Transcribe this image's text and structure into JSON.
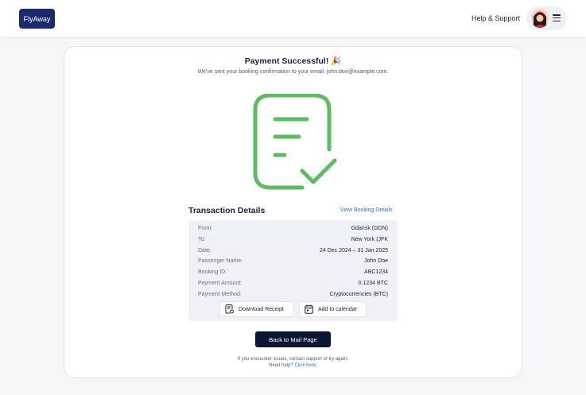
{
  "header": {
    "logo_text": "FlyAway",
    "help_label": "Help & Support",
    "menu_icon": "hamburger-menu-icon"
  },
  "main": {
    "title": "Payment Successful! 🎉",
    "subtitle": "We've sent your booking confirmation to your email: john.doe@example.com.",
    "success_icon": "receipt-check-icon",
    "transaction_heading": "Transaction Details",
    "view_booking_label": "View Booking Details",
    "details": [
      {
        "label": "From:",
        "value": "Gdańsk (GDN)"
      },
      {
        "label": "To:",
        "value": "New York (JFK"
      },
      {
        "label": "Date:",
        "value": "24 Dec 2024 – 31 Jan 2025"
      },
      {
        "label": "Passenger Name:",
        "value": "John Doe"
      },
      {
        "label": "Booking ID:",
        "value": "ABC1234"
      },
      {
        "label": "Payment Amount:",
        "value": "0.1234 BTC"
      },
      {
        "label": "Payment Method:",
        "value": "Cryptocurrencies (BTC)"
      }
    ],
    "download_label": "Download Receipt",
    "calendar_label": "Add to calendar",
    "back_label": "Back to Mail Page"
  },
  "footer": {
    "line1": "If you encounter issues, contact support or try again.",
    "line2_prefix": "Need help?",
    "line2_link": "Click here."
  },
  "colors": {
    "brand": "#1a2a6c",
    "success": "#5dbb63",
    "link": "#2a6fd6",
    "primary_button": "#0d1535"
  }
}
